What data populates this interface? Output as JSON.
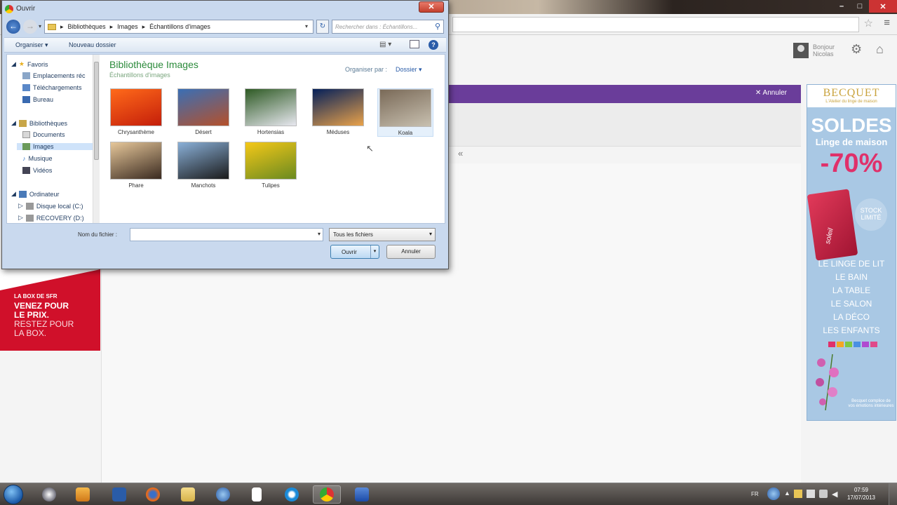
{
  "browser": {
    "window_controls": [
      "–",
      "□",
      "✕"
    ],
    "user_greeting": [
      "Bonjour",
      "Nicolas"
    ],
    "purple_bar_cancel": "Annuler",
    "collapse_glyph": "«"
  },
  "ads": {
    "sfr": {
      "small": "LA BOX DE SFR",
      "big": [
        "VENEZ POUR",
        "LE PRIX."
      ],
      "light": [
        "RESTEZ POUR",
        "LA BOX."
      ]
    },
    "becquet": {
      "brand": "BECQUET",
      "tagline": "L'Atelier du linge de maison",
      "soldes": "SOLDES",
      "linge": "Linge de maison",
      "discount": "-70%",
      "badge": "STOCK LIMITÉ",
      "bag_text": "soleil",
      "categories": [
        "LE LINGE DE LIT",
        "LE BAIN",
        "LA TABLE",
        "LE SALON",
        "LA DÉCO",
        "LES ENFANTS"
      ],
      "fine_print": "Becquet complice de vos émotions intérieures",
      "swatch_colors": [
        "#e0306a",
        "#f5a623",
        "#7ec843",
        "#4a90e2",
        "#b04ad0",
        "#e04a8a"
      ]
    }
  },
  "dialog": {
    "title": "Ouvrir",
    "close_glyph": "✕",
    "address": [
      "Bibliothèques",
      "Images",
      "Échantillons d'images"
    ],
    "search_placeholder": "Rechercher dans : Échantillons...",
    "toolbar": {
      "organize": "Organiser ▾",
      "new_folder": "Nouveau dossier"
    },
    "nav": {
      "favorites_header": "Favoris",
      "favorites": [
        "Emplacements réc",
        "Téléchargements",
        "Bureau"
      ],
      "libraries_header": "Bibliothèques",
      "libraries": [
        "Documents",
        "Images",
        "Musique",
        "Vidéos"
      ],
      "computer_header": "Ordinateur",
      "drives": [
        "Disque local (C:)",
        "RECOVERY (D:)"
      ]
    },
    "library_title": "Bibliothèque Images",
    "library_subtitle": "Échantillons d'images",
    "arrange_label": "Organiser par :",
    "arrange_value": "Dossier ▾",
    "files": [
      {
        "name": "Chrysanthème",
        "colors": [
          "#ff6a1a",
          "#c41e0a"
        ]
      },
      {
        "name": "Désert",
        "colors": [
          "#3a6fb5",
          "#b5502a"
        ]
      },
      {
        "name": "Hortensias",
        "colors": [
          "#2e5a24",
          "#e8e8f0"
        ]
      },
      {
        "name": "Méduses",
        "colors": [
          "#05205a",
          "#e9a24a"
        ]
      },
      {
        "name": "Koala",
        "colors": [
          "#7a6a58",
          "#c8c0b0"
        ]
      },
      {
        "name": "Phare",
        "colors": [
          "#e6c79a",
          "#3a2a20"
        ]
      },
      {
        "name": "Manchots",
        "colors": [
          "#8ab0d8",
          "#1a1a1a"
        ]
      },
      {
        "name": "Tulipes",
        "colors": [
          "#f5c818",
          "#6a8a20"
        ]
      }
    ],
    "filename_label": "Nom du fichier :",
    "filename_value": "",
    "filetype": "Tous les fichiers",
    "open_button": "Ouvrir",
    "cancel_button": "Annuler"
  },
  "taskbar": {
    "language": "FR",
    "time": "07:59",
    "date": "17/07/2013"
  }
}
